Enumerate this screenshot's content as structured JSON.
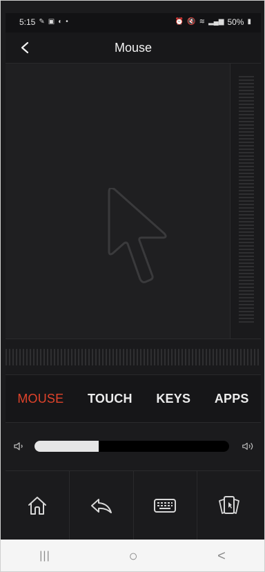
{
  "status_bar": {
    "time": "5:15",
    "battery": "50%"
  },
  "header": {
    "title": "Mouse"
  },
  "tabs": [
    {
      "label": "MOUSE",
      "active": true
    },
    {
      "label": "TOUCH",
      "active": false
    },
    {
      "label": "KEYS",
      "active": false
    },
    {
      "label": "APPS",
      "active": false
    }
  ],
  "volume": {
    "level": 0.33
  },
  "bottom_actions": [
    {
      "icon": "home-icon"
    },
    {
      "icon": "back-arrow-icon"
    },
    {
      "icon": "keyboard-icon"
    },
    {
      "icon": "remote-cards-icon"
    }
  ],
  "system_nav": {
    "recents": "|||",
    "home": "○",
    "back": "<"
  },
  "colors": {
    "accent": "#e0432b",
    "background": "#1c1c1e",
    "slider_fill": "#e6e6e6"
  }
}
